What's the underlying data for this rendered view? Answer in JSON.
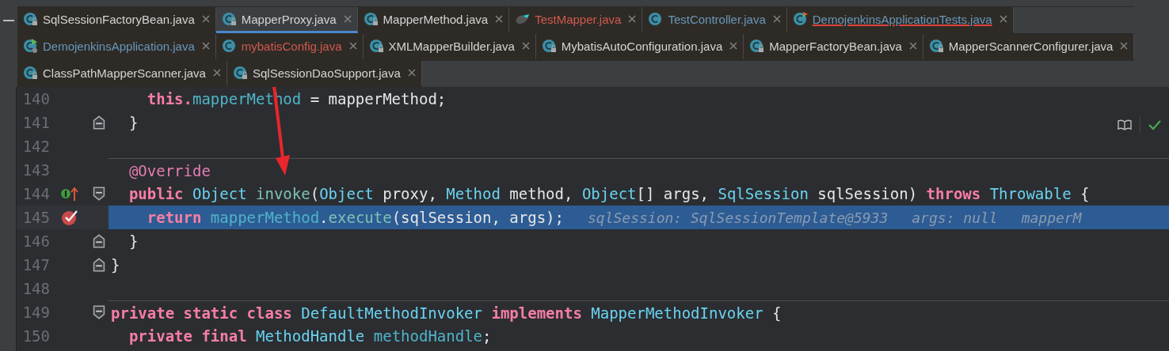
{
  "tab_rows": [
    [
      {
        "label": "SqlSessionFactoryBean.java",
        "kind": "class",
        "locked": true,
        "underlined": false,
        "color": "#d4d4d4",
        "selected": false
      },
      {
        "label": "MapperProxy.java",
        "kind": "class",
        "locked": true,
        "underlined": false,
        "color": "#d4d4d4",
        "selected": true
      },
      {
        "label": "MapperMethod.java",
        "kind": "class",
        "locked": true,
        "underlined": false,
        "color": "#d4d4d4",
        "selected": false
      },
      {
        "label": "TestMapper.java",
        "kind": "mapper",
        "locked": false,
        "underlined": false,
        "color": "#d2594f",
        "selected": false
      },
      {
        "label": "TestController.java",
        "kind": "class",
        "locked": false,
        "underlined": false,
        "color": "#6897bb",
        "selected": false
      },
      {
        "label": "DemojenkinsApplicationTests.java",
        "kind": "test",
        "locked": false,
        "underlined": true,
        "color": "#6897bb",
        "selected": false
      }
    ],
    [
      {
        "label": "DemojenkinsApplication.java",
        "kind": "app",
        "locked": false,
        "underlined": false,
        "color": "#6897bb",
        "selected": false
      },
      {
        "label": "mybatisConfig.java",
        "kind": "class",
        "locked": false,
        "underlined": false,
        "color": "#d2594f",
        "selected": false
      },
      {
        "label": "XMLMapperBuilder.java",
        "kind": "class",
        "locked": true,
        "underlined": false,
        "color": "#d4d4d4",
        "selected": false
      },
      {
        "label": "MybatisAutoConfiguration.java",
        "kind": "class",
        "locked": true,
        "underlined": false,
        "color": "#d4d4d4",
        "selected": false
      },
      {
        "label": "MapperFactoryBean.java",
        "kind": "class",
        "locked": true,
        "underlined": false,
        "color": "#d4d4d4",
        "selected": false
      },
      {
        "label": "MapperScannerConfigurer.java",
        "kind": "class",
        "locked": true,
        "underlined": false,
        "color": "#d4d4d4",
        "selected": false
      }
    ],
    [
      {
        "label": "ClassPathMapperScanner.java",
        "kind": "class",
        "locked": true,
        "underlined": false,
        "color": "#d4d4d4",
        "selected": false
      },
      {
        "label": "SqlSessionDaoSupport.java",
        "kind": "class",
        "locked": true,
        "underlined": false,
        "color": "#d4d4d4",
        "selected": false
      }
    ]
  ],
  "lines": [
    {
      "number": "140",
      "highlighted": false,
      "separator": false,
      "breakpoint": false,
      "implements_marker": false,
      "fold_open": false,
      "fold_close": false,
      "tokens": [
        {
          "kind": "kw",
          "text": "    this."
        },
        {
          "kind": "field",
          "text": "mapperMethod"
        },
        {
          "kind": "plain",
          "text": " = mapperMethod;"
        }
      ]
    },
    {
      "number": "141",
      "highlighted": false,
      "separator": false,
      "breakpoint": false,
      "implements_marker": false,
      "fold_open": false,
      "fold_close": true,
      "tokens": [
        {
          "kind": "plain",
          "text": "  }"
        }
      ]
    },
    {
      "number": "142",
      "highlighted": false,
      "separator": false,
      "breakpoint": false,
      "implements_marker": false,
      "fold_open": false,
      "fold_close": false
    },
    {
      "number": "143",
      "highlighted": false,
      "separator": true,
      "breakpoint": false,
      "implements_marker": false,
      "fold_open": false,
      "fold_close": false,
      "tokens": [
        {
          "kind": "annot",
          "text": "  @Override"
        }
      ]
    },
    {
      "number": "144",
      "highlighted": false,
      "separator": false,
      "breakpoint": false,
      "implements_marker": true,
      "fold_open": true,
      "fold_close": false,
      "tokens": [
        {
          "kind": "kw",
          "text": "  public"
        },
        {
          "kind": "type",
          "text": " Object"
        },
        {
          "kind": "fn",
          "text": " invoke"
        },
        {
          "kind": "plain",
          "text": "("
        },
        {
          "kind": "type",
          "text": "Object"
        },
        {
          "kind": "plain",
          "text": " proxy, "
        },
        {
          "kind": "type",
          "text": "Method"
        },
        {
          "kind": "plain",
          "text": " method, "
        },
        {
          "kind": "type",
          "text": "Object"
        },
        {
          "kind": "plain",
          "text": "[] args, "
        },
        {
          "kind": "type",
          "text": "SqlSession"
        },
        {
          "kind": "plain",
          "text": " sqlSession) "
        },
        {
          "kind": "kw",
          "text": "throws"
        },
        {
          "kind": "type",
          "text": " Throwable"
        },
        {
          "kind": "plain",
          "text": " {"
        }
      ]
    },
    {
      "number": "145",
      "highlighted": true,
      "separator": false,
      "breakpoint": true,
      "implements_marker": false,
      "fold_open": false,
      "fold_close": false,
      "tokens": [
        {
          "kind": "kw",
          "text": "    return"
        },
        {
          "kind": "field",
          "text": " mapperMethod"
        },
        {
          "kind": "plain",
          "text": "."
        },
        {
          "kind": "fn",
          "text": "execute"
        },
        {
          "kind": "plain",
          "text": "(sqlSession, args);"
        }
      ],
      "hints": [
        "sqlSession: SqlSessionTemplate@5933",
        "args: null",
        "mapperM"
      ]
    },
    {
      "number": "146",
      "highlighted": false,
      "separator": false,
      "breakpoint": false,
      "implements_marker": false,
      "fold_open": false,
      "fold_close": true,
      "tokens": [
        {
          "kind": "plain",
          "text": "  }"
        }
      ]
    },
    {
      "number": "147",
      "highlighted": false,
      "separator": false,
      "breakpoint": false,
      "implements_marker": false,
      "fold_open": false,
      "fold_close": true,
      "tokens": [
        {
          "kind": "plain",
          "text": "}"
        }
      ]
    },
    {
      "number": "148",
      "highlighted": false,
      "separator": false,
      "breakpoint": false,
      "implements_marker": false,
      "fold_open": false,
      "fold_close": false
    },
    {
      "number": "149",
      "highlighted": false,
      "separator": true,
      "breakpoint": false,
      "implements_marker": false,
      "fold_open": true,
      "fold_close": false,
      "tokens": [
        {
          "kind": "kw",
          "text": "private static class"
        },
        {
          "kind": "type",
          "text": " DefaultMethodInvoker"
        },
        {
          "kind": "kw",
          "text": " implements"
        },
        {
          "kind": "type",
          "text": " MapperMethodInvoker"
        },
        {
          "kind": "plain",
          "text": " {"
        }
      ]
    },
    {
      "number": "150",
      "highlighted": false,
      "separator": false,
      "breakpoint": false,
      "implements_marker": false,
      "fold_open": false,
      "fold_close": false,
      "tokens": [
        {
          "kind": "kw",
          "text": "  private final"
        },
        {
          "kind": "type",
          "text": " MethodHandle"
        },
        {
          "kind": "field",
          "text": " methodHandle"
        },
        {
          "kind": "plain",
          "text": ";"
        }
      ]
    }
  ]
}
